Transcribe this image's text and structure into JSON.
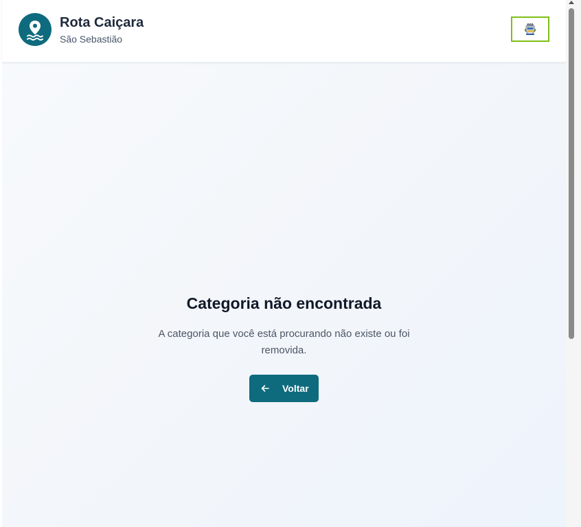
{
  "header": {
    "brand_title": "Rota Caiçara",
    "brand_subtitle": "São Sebastião",
    "logo_icon": "map-pin-waves-icon",
    "crest_icon": "city-crest-icon"
  },
  "not_found": {
    "title": "Categoria não encontrada",
    "message": "A categoria que você está procurando não existe ou foi removida.",
    "back_button_label": "Voltar",
    "back_icon": "arrow-left-icon"
  },
  "colors": {
    "primary": "#0e6b7e",
    "crest_highlight": "#7cc015",
    "title_text": "#111827",
    "body_text": "#4b5563"
  }
}
